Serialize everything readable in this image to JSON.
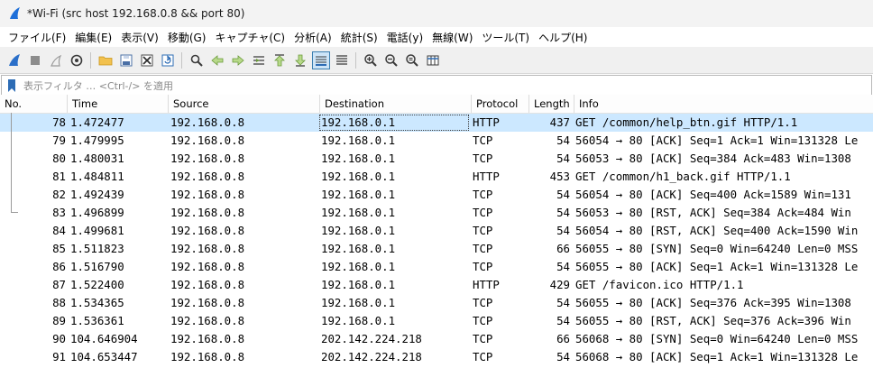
{
  "window": {
    "title": "*Wi-Fi (src host 192.168.0.8 && port 80)"
  },
  "menu": [
    "ファイル(F)",
    "編集(E)",
    "表示(V)",
    "移動(G)",
    "キャプチャ(C)",
    "分析(A)",
    "統計(S)",
    "電話(y)",
    "無線(W)",
    "ツール(T)",
    "ヘルプ(H)"
  ],
  "filter": {
    "placeholder": "表示フィルタ … <Ctrl-/> を適用",
    "value": ""
  },
  "columns": [
    "No.",
    "Time",
    "Source",
    "Destination",
    "Protocol",
    "Length",
    "Info"
  ],
  "packets": [
    {
      "no": "78",
      "time": "1.472477",
      "src": "192.168.0.8",
      "dst": "192.168.0.1",
      "proto": "HTTP",
      "len": "437",
      "info": "GET /common/help_btn.gif HTTP/1.1"
    },
    {
      "no": "79",
      "time": "1.479995",
      "src": "192.168.0.8",
      "dst": "192.168.0.1",
      "proto": "TCP",
      "len": "54",
      "info": "56054 → 80 [ACK] Seq=1 Ack=1 Win=131328 Le"
    },
    {
      "no": "80",
      "time": "1.480031",
      "src": "192.168.0.8",
      "dst": "192.168.0.1",
      "proto": "TCP",
      "len": "54",
      "info": "56053 → 80 [ACK] Seq=384 Ack=483 Win=1308"
    },
    {
      "no": "81",
      "time": "1.484811",
      "src": "192.168.0.8",
      "dst": "192.168.0.1",
      "proto": "HTTP",
      "len": "453",
      "info": "GET /common/h1_back.gif HTTP/1.1"
    },
    {
      "no": "82",
      "time": "1.492439",
      "src": "192.168.0.8",
      "dst": "192.168.0.1",
      "proto": "TCP",
      "len": "54",
      "info": "56054 → 80 [ACK] Seq=400 Ack=1589 Win=131"
    },
    {
      "no": "83",
      "time": "1.496899",
      "src": "192.168.0.8",
      "dst": "192.168.0.1",
      "proto": "TCP",
      "len": "54",
      "info": "56053 → 80 [RST, ACK] Seq=384 Ack=484 Win"
    },
    {
      "no": "84",
      "time": "1.499681",
      "src": "192.168.0.8",
      "dst": "192.168.0.1",
      "proto": "TCP",
      "len": "54",
      "info": "56054 → 80 [RST, ACK] Seq=400 Ack=1590 Win"
    },
    {
      "no": "85",
      "time": "1.511823",
      "src": "192.168.0.8",
      "dst": "192.168.0.1",
      "proto": "TCP",
      "len": "66",
      "info": "56055 → 80 [SYN] Seq=0 Win=64240 Len=0 MSS"
    },
    {
      "no": "86",
      "time": "1.516790",
      "src": "192.168.0.8",
      "dst": "192.168.0.1",
      "proto": "TCP",
      "len": "54",
      "info": "56055 → 80 [ACK] Seq=1 Ack=1 Win=131328 Le"
    },
    {
      "no": "87",
      "time": "1.522400",
      "src": "192.168.0.8",
      "dst": "192.168.0.1",
      "proto": "HTTP",
      "len": "429",
      "info": "GET /favicon.ico HTTP/1.1"
    },
    {
      "no": "88",
      "time": "1.534365",
      "src": "192.168.0.8",
      "dst": "192.168.0.1",
      "proto": "TCP",
      "len": "54",
      "info": "56055 → 80 [ACK] Seq=376 Ack=395 Win=1308"
    },
    {
      "no": "89",
      "time": "1.536361",
      "src": "192.168.0.8",
      "dst": "192.168.0.1",
      "proto": "TCP",
      "len": "54",
      "info": "56055 → 80 [RST, ACK] Seq=376 Ack=396 Win"
    },
    {
      "no": "90",
      "time": "104.646904",
      "src": "192.168.0.8",
      "dst": "202.142.224.218",
      "proto": "TCP",
      "len": "66",
      "info": "56068 → 80 [SYN] Seq=0 Win=64240 Len=0 MSS"
    },
    {
      "no": "91",
      "time": "104.653447",
      "src": "192.168.0.8",
      "dst": "202.142.224.218",
      "proto": "TCP",
      "len": "54",
      "info": "56068 → 80 [ACK] Seq=1 Ack=1 Win=131328 Le"
    }
  ],
  "selected_packet": "78",
  "colors": {
    "selection": "#cce8ff",
    "accent": "#3c7fb1"
  }
}
